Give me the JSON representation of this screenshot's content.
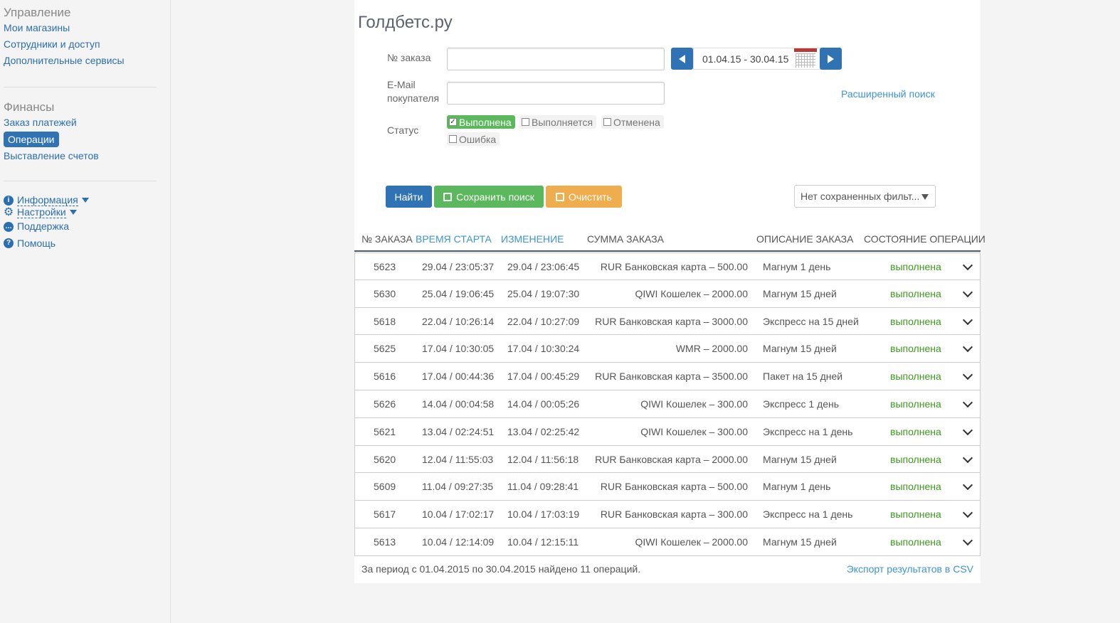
{
  "sidebar": {
    "management": {
      "heading": "Управление",
      "links": [
        "Мои магазины",
        "Сотрудники и доступ",
        "Дополнительные сервисы"
      ]
    },
    "finance": {
      "heading": "Финансы",
      "links": [
        "Заказ платежей",
        "Операции",
        "Выставление счетов"
      ],
      "active": "Операции"
    },
    "utility": [
      {
        "label": "Информация",
        "icon": "info-icon"
      },
      {
        "label": "Настройки",
        "icon": "gear-icon"
      },
      {
        "label": "Поддержка",
        "icon": "chat-icon"
      },
      {
        "label": "Помощь",
        "icon": "help-icon"
      }
    ]
  },
  "page": {
    "title": "Голдбетс.ру"
  },
  "filters": {
    "order_label": "№ заказа",
    "email_label_1": "E-Mail",
    "email_label_2": "покупателя",
    "status_label": "Статус",
    "date_range": "01.04.15 - 30.04.15",
    "advanced_search": "Расширенный поиск",
    "statuses": [
      {
        "label": "Выполнена",
        "checked": true
      },
      {
        "label": "Выполняется",
        "checked": false
      },
      {
        "label": "Отменена",
        "checked": false
      },
      {
        "label": "Ошибка",
        "checked": false
      }
    ]
  },
  "buttons": {
    "find": "Найти",
    "save_search": "Сохранить поиск",
    "clear": "Очистить",
    "saved_filters": "Нет сохраненных фильт..."
  },
  "table": {
    "headers": {
      "id": "№ ЗАКАЗА",
      "start": "ВРЕМЯ СТАРТА",
      "updated": "ИЗМЕНЕНИЕ",
      "sum": "СУММА ЗАКАЗА",
      "description": "ОПИСАНИЕ ЗАКАЗА",
      "state": "СОСТОЯНИЕ ОПЕРАЦИИ"
    },
    "rows": [
      {
        "id": "5623",
        "start": "29.04 / 23:05:37",
        "updated": "29.04 / 23:06:45",
        "sum": "RUR Банковская карта  – 500.00",
        "description": "Магнум 1 день",
        "state": "выполнена"
      },
      {
        "id": "5630",
        "start": "25.04 / 19:06:45",
        "updated": "25.04 / 19:07:30",
        "sum": "QIWI Кошелек  – 2000.00",
        "description": "Магнум 15 дней",
        "state": "выполнена"
      },
      {
        "id": "5618",
        "start": "22.04 / 10:26:14",
        "updated": "22.04 / 10:27:09",
        "sum": "RUR Банковская карта  – 3000.00",
        "description": "Экспресс на 15 дней",
        "state": "выполнена"
      },
      {
        "id": "5625",
        "start": "17.04 / 10:30:05",
        "updated": "17.04 / 10:30:24",
        "sum": "WMR  – 2000.00",
        "description": "Магнум 15 дней",
        "state": "выполнена"
      },
      {
        "id": "5616",
        "start": "17.04 / 00:44:36",
        "updated": "17.04 / 00:45:29",
        "sum": "RUR Банковская карта  – 3500.00",
        "description": "Пакет на 15 дней",
        "state": "выполнена"
      },
      {
        "id": "5626",
        "start": "14.04 / 00:04:58",
        "updated": "14.04 / 00:05:26",
        "sum": "QIWI Кошелек  – 300.00",
        "description": "Экспресс 1 день",
        "state": "выполнена"
      },
      {
        "id": "5621",
        "start": "13.04 / 02:24:51",
        "updated": "13.04 / 02:25:42",
        "sum": "QIWI Кошелек  – 300.00",
        "description": "Экспресс на 1 день",
        "state": "выполнена"
      },
      {
        "id": "5620",
        "start": "12.04 / 11:55:03",
        "updated": "12.04 / 11:56:18",
        "sum": "RUR Банковская карта  – 2000.00",
        "description": "Магнум 15 дней",
        "state": "выполнена"
      },
      {
        "id": "5609",
        "start": "11.04 / 09:27:35",
        "updated": "11.04 / 09:28:41",
        "sum": "RUR Банковская карта  – 500.00",
        "description": "Магнум 1 день",
        "state": "выполнена"
      },
      {
        "id": "5617",
        "start": "10.04 / 17:02:17",
        "updated": "10.04 / 17:03:19",
        "sum": "RUR Банковская карта  – 300.00",
        "description": "Экспресс на 1 день",
        "state": "выполнена"
      },
      {
        "id": "5613",
        "start": "10.04 / 12:14:09",
        "updated": "10.04 / 12:15:11",
        "sum": "QIWI Кошелек  – 2000.00",
        "description": "Магнум 15 дней",
        "state": "выполнена"
      }
    ],
    "summary": "За период с 01.04.2015 по 30.04.2015 найдено 11 операций.",
    "export": "Экспорт результатов в CSV"
  },
  "colors": {
    "primary": "#2f73b4",
    "success": "#5cb85c",
    "warning": "#f0ad4e",
    "state_text": "#3c9a1c"
  }
}
